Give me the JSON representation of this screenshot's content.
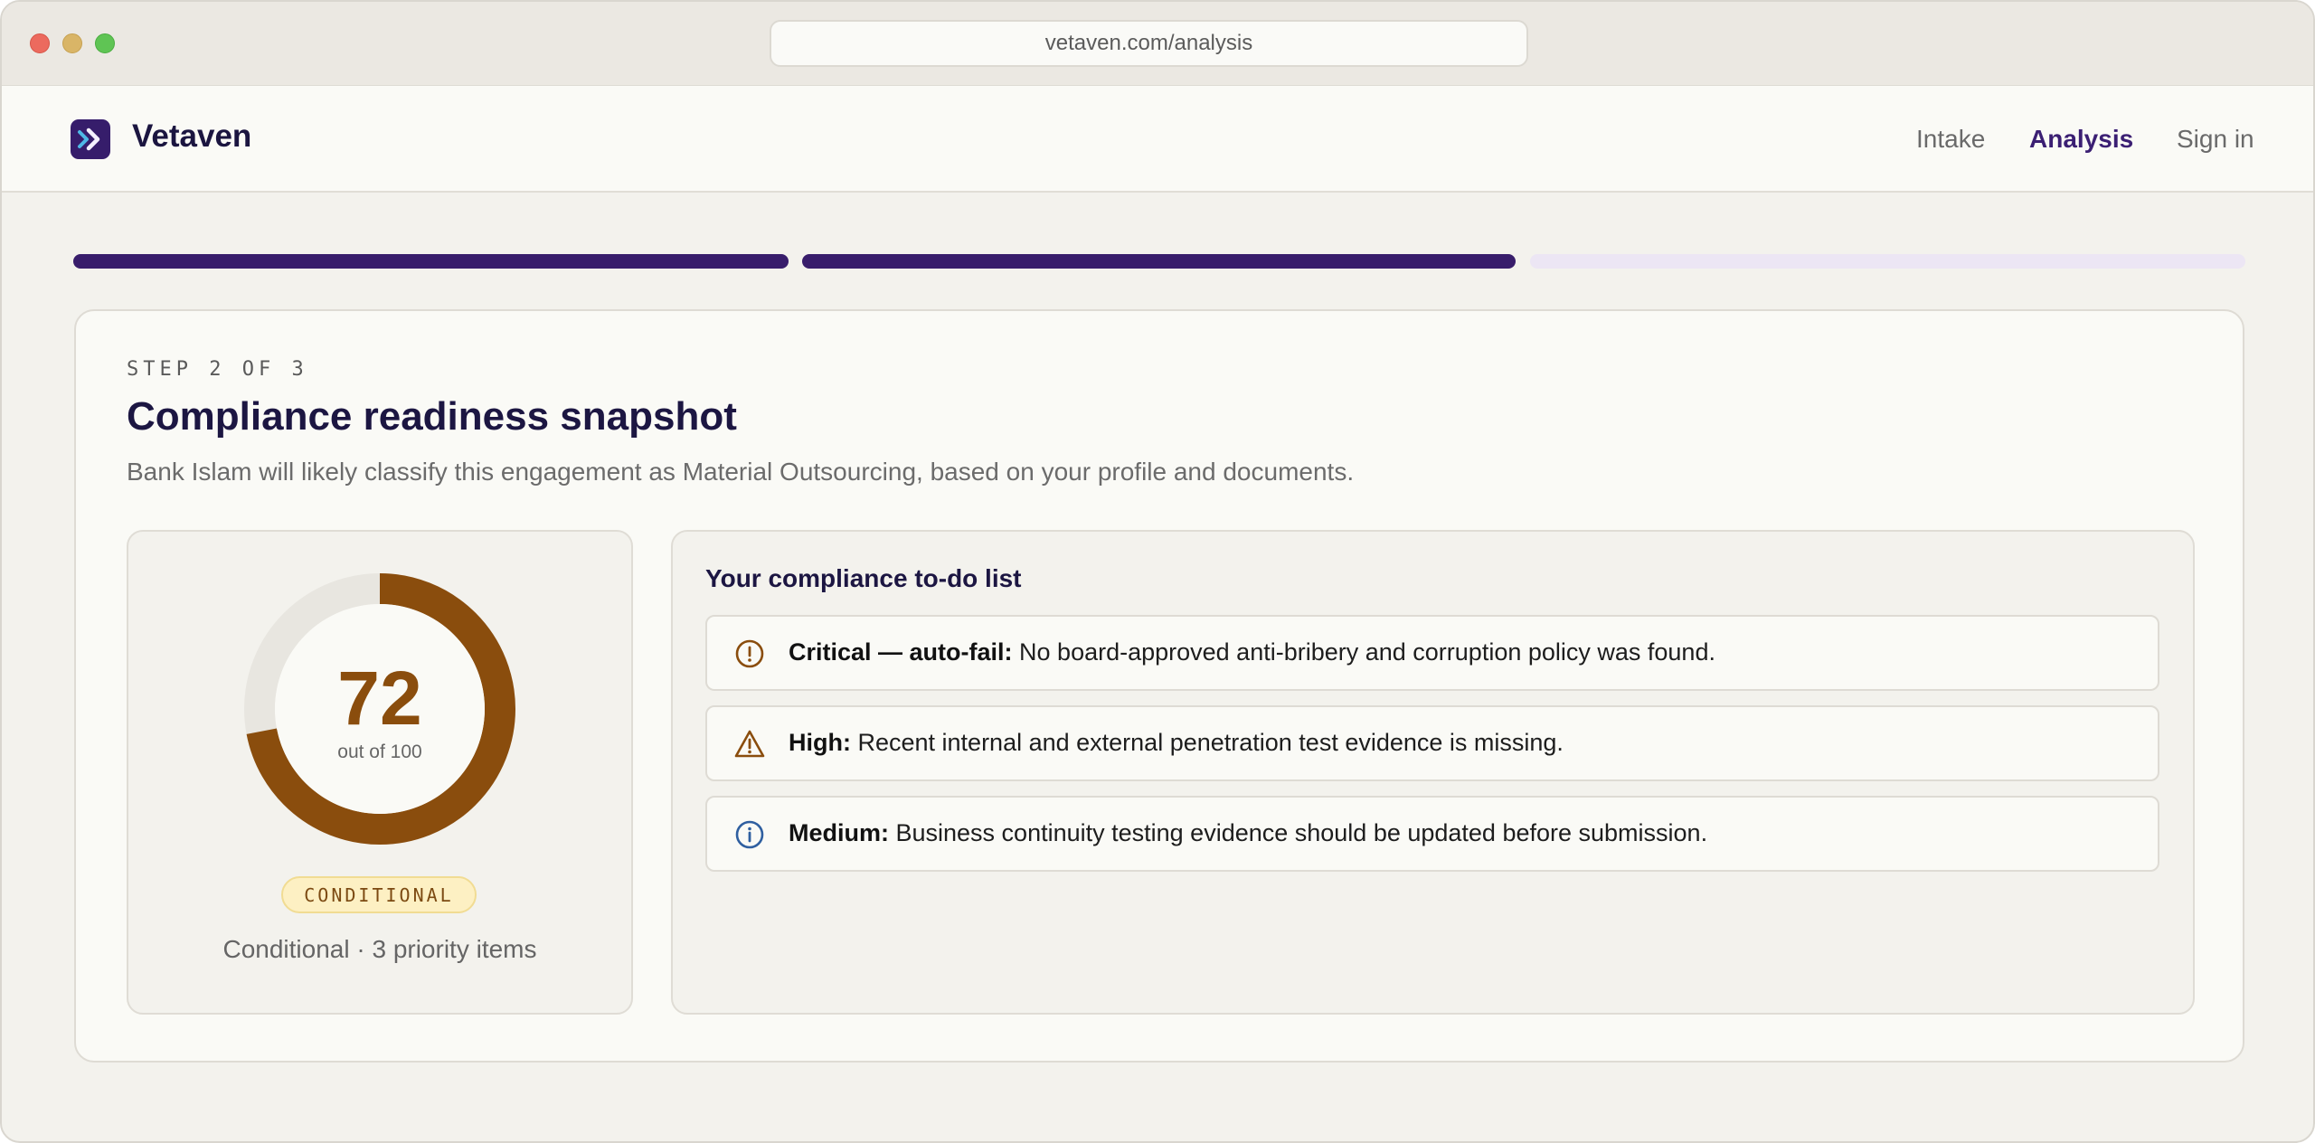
{
  "browser": {
    "url": "vetaven.com/analysis"
  },
  "header": {
    "brand": "Vetaven",
    "nav": [
      "Intake",
      "Analysis",
      "Sign in"
    ],
    "active_nav": "Analysis"
  },
  "progress": {
    "completed_segments": 2,
    "total_segments": 3
  },
  "card": {
    "step": "STEP 2 OF 3",
    "title": "Compliance readiness snapshot",
    "subtitle": "Bank Islam will likely classify this engagement as Material Outsourcing, based on your profile and documents."
  },
  "score": {
    "value": "72",
    "value_fraction": 0.72,
    "out_of": "out of 100",
    "badge": "CONDITIONAL",
    "caption": "Conditional · 3 priority items",
    "color": "#8a4d0d"
  },
  "todo": {
    "title": "Your compliance to-do list",
    "items": [
      {
        "icon": "alert-circle-icon",
        "severity": "Critical — auto-fail:",
        "text": " No board-approved anti-bribery and corruption policy was found.",
        "color": "#8a4d0d"
      },
      {
        "icon": "warning-triangle-icon",
        "severity": "High:",
        "text": " Recent internal and external penetration test evidence is missing.",
        "color": "#8a4d0d"
      },
      {
        "icon": "info-circle-icon",
        "severity": "Medium:",
        "text": " Business continuity testing evidence should be updated before submission.",
        "color": "#2f5fa0"
      }
    ]
  },
  "colors": {
    "primary": "#381d6b",
    "accent_score": "#8a4d0d",
    "progress_inactive": "#ece6f4"
  }
}
